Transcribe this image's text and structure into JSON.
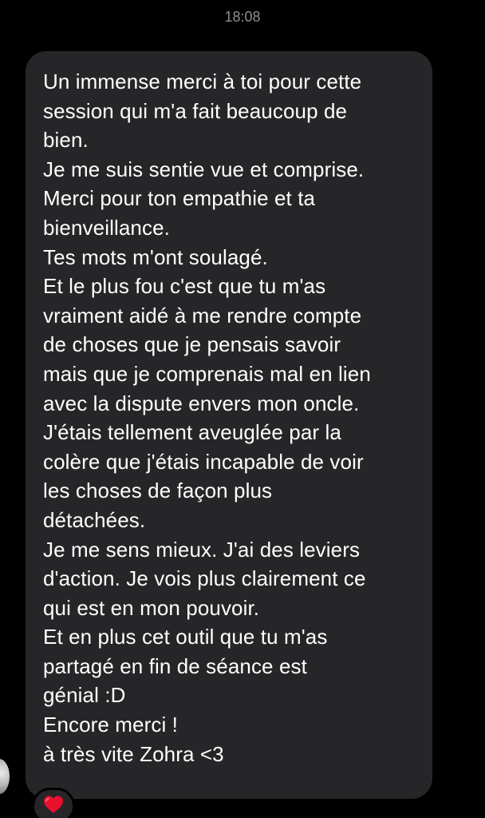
{
  "timestamp": "18:08",
  "message": {
    "lines": [
      "Un immense merci à toi pour cette",
      "session qui m'a fait beaucoup de",
      "bien.",
      "Je me suis sentie vue et comprise.",
      "Merci pour ton empathie et ta",
      "bienveillance.",
      "Tes mots m'ont soulagé.",
      "Et le plus fou c'est que tu m'as",
      "vraiment aidé à me rendre compte",
      "de choses que je pensais savoir",
      "mais que je comprenais mal en lien",
      "avec la dispute envers mon oncle.",
      "J'étais tellement aveuglée par la",
      "colère que j'étais incapable de voir",
      "les choses de façon plus",
      "détachées.",
      "Je me sens mieux. J'ai des leviers",
      "d'action. Je vois plus clairement ce",
      "qui est en mon pouvoir.",
      "Et en plus cet outil que tu m'as",
      "partagé en fin de séance est",
      "génial :D",
      "Encore merci !",
      "à très vite Zohra <3"
    ]
  },
  "reaction": {
    "icon": "red-heart-icon",
    "color": "#e8112d"
  },
  "colors": {
    "background": "#000000",
    "bubble": "#262629",
    "text": "#ffffff",
    "timestamp": "#8e8e93"
  }
}
